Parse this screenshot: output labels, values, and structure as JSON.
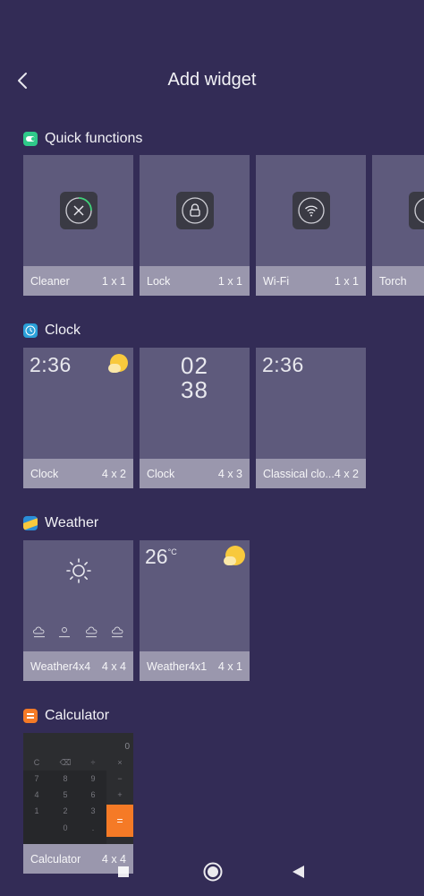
{
  "header": {
    "title": "Add widget"
  },
  "sections": {
    "quick_functions": {
      "title": "Quick functions",
      "widgets": [
        {
          "label": "Cleaner",
          "size": "1 x 1"
        },
        {
          "label": "Lock",
          "size": "1 x 1"
        },
        {
          "label": "Wi-Fi",
          "size": "1 x 1"
        },
        {
          "label": "Torch",
          "size": ""
        }
      ]
    },
    "clock": {
      "title": "Clock",
      "widgets": [
        {
          "label": "Clock",
          "size": "4 x 2",
          "time": "2:36"
        },
        {
          "label": "Clock",
          "size": "4 x 3",
          "hours": "02",
          "minutes": "38"
        },
        {
          "label": "Classical clo...",
          "size": "4 x 2",
          "time": "2:36"
        }
      ]
    },
    "weather": {
      "title": "Weather",
      "widgets": [
        {
          "label": "Weather4x4",
          "size": "4 x 4"
        },
        {
          "label": "Weather4x1",
          "size": "4 x 1",
          "temperature": "26",
          "unit": "°C"
        }
      ]
    },
    "calculator": {
      "title": "Calculator",
      "widgets": [
        {
          "label": "Calculator",
          "size": "4 x 4",
          "display": "0"
        }
      ]
    }
  },
  "colors": {
    "background": "#332c56",
    "card": "#5e5a7c",
    "label_bar": "#9a97ad",
    "quick_functions_icon": "#2fc98a",
    "clock_icon": "#2aa0d8",
    "weather_icon_blue": "#2a8ed8",
    "weather_icon_yellow": "#f8c93d",
    "calculator_icon": "#f57a26"
  },
  "icons": {
    "back": "chevron-left-icon",
    "cleaner": "close-circle-icon",
    "lock": "lock-icon",
    "wifi": "wifi-icon",
    "weather": "sun-icon",
    "nav_recents": "square-icon",
    "nav_home": "circle-icon",
    "nav_back": "triangle-left-icon"
  }
}
